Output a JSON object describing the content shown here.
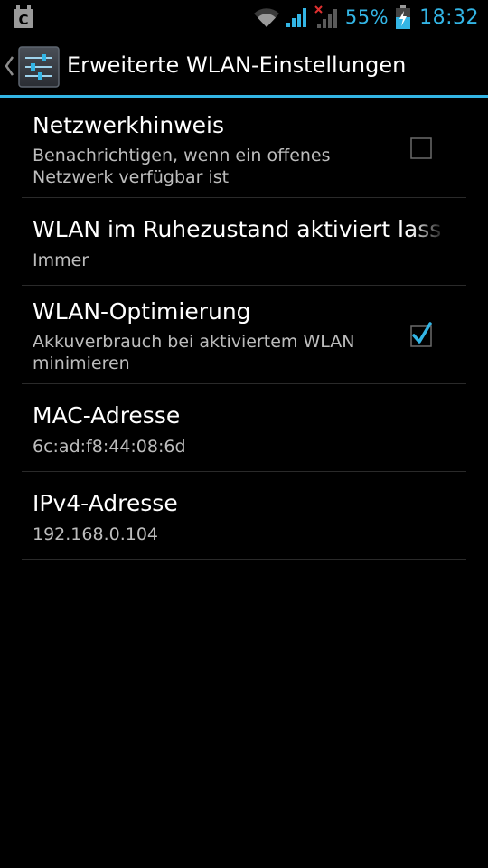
{
  "status_bar": {
    "battery_percent": "55%",
    "battery_level": 0.55,
    "time": "18:32",
    "left_icon": "notification-app-icon",
    "icons": [
      "wifi-icon",
      "signal-icon",
      "signal-no-service-icon",
      "battery-charging-icon"
    ],
    "accent_color": "#33b5e5"
  },
  "action_bar": {
    "title": "Erweiterte WLAN-Einstellungen",
    "up_icon": "chevron-left-icon",
    "app_icon": "settings-sliders-icon",
    "accent_color": "#33b5e5"
  },
  "preferences": [
    {
      "title": "Netzwerkhinweis",
      "summary": "Benachrichtigen, wenn ein offenes Netzwerk verfügbar ist",
      "checkbox": true,
      "checked": false
    },
    {
      "title": "WLAN im Ruhezustand aktiviert lassen",
      "summary": "Immer",
      "checkbox": false
    },
    {
      "title": "WLAN-Optimierung",
      "summary": "Akkuverbrauch bei aktiviertem WLAN minimieren",
      "checkbox": true,
      "checked": true
    },
    {
      "title": "MAC-Adresse",
      "summary": "6c:ad:f8:44:08:6d",
      "checkbox": false
    },
    {
      "title": "IPv4-Adresse",
      "summary": "192.168.0.104",
      "checkbox": false
    }
  ]
}
